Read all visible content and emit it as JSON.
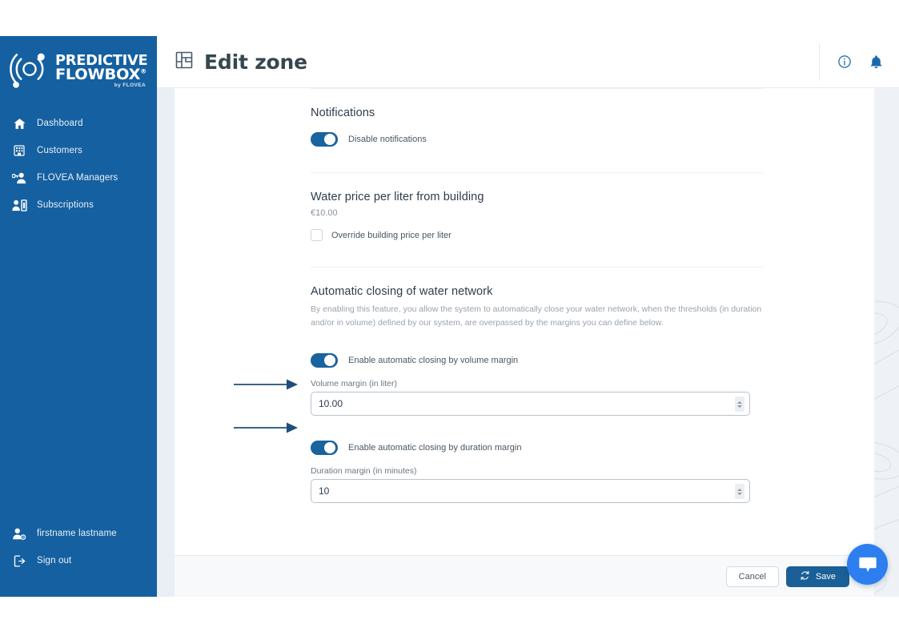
{
  "brand": {
    "logo_line1": "PREDICTIVE",
    "logo_line2": "FLOWBOX",
    "logo_registered": "®",
    "logo_byline": "by FLOVEA",
    "sidebar_color": "#1560a0",
    "accent_color": "#19639f",
    "chat_color": "#2d7ff0"
  },
  "sidebar": {
    "items": [
      {
        "label": "Dashboard",
        "icon": "home-icon"
      },
      {
        "label": "Customers",
        "icon": "building-icon"
      },
      {
        "label": "FLOVEA Managers",
        "icon": "user-key-icon"
      },
      {
        "label": "Subscriptions",
        "icon": "user-card-icon"
      }
    ],
    "bottom_items": [
      {
        "label": "firstname lastname",
        "icon": "user-settings-icon"
      },
      {
        "label": "Sign out",
        "icon": "sign-out-icon"
      }
    ]
  },
  "header": {
    "title": "Edit zone",
    "title_icon": "zone-plan-icon",
    "info_icon": "info-circle-icon",
    "bell_icon": "bell-icon"
  },
  "sections": {
    "notifications": {
      "title": "Notifications",
      "toggle_label": "Disable notifications",
      "toggle_on": true
    },
    "water_price": {
      "title": "Water price per liter from building",
      "value": "€10.00",
      "checkbox_label": "Override building price per liter",
      "checked": false
    },
    "auto_closing": {
      "title": "Automatic closing of water network",
      "description": "By enabling this feature, you allow the system to automatically close your water network, when the thresholds (in duration and/or in volume) defined by our system, are overpassed by the margins you can define below.",
      "volume_toggle_label": "Enable automatic closing by volume margin",
      "volume_toggle_on": true,
      "volume_field_label": "Volume margin (in liter)",
      "volume_value": "10.00",
      "duration_toggle_label": "Enable automatic closing by duration margin",
      "duration_toggle_on": true,
      "duration_field_label": "Duration margin (in minutes)",
      "duration_value": "10"
    }
  },
  "footer": {
    "cancel_label": "Cancel",
    "save_label": "Save",
    "save_icon": "refresh-icon"
  },
  "chat": {
    "icon": "chat-bubble-icon"
  }
}
